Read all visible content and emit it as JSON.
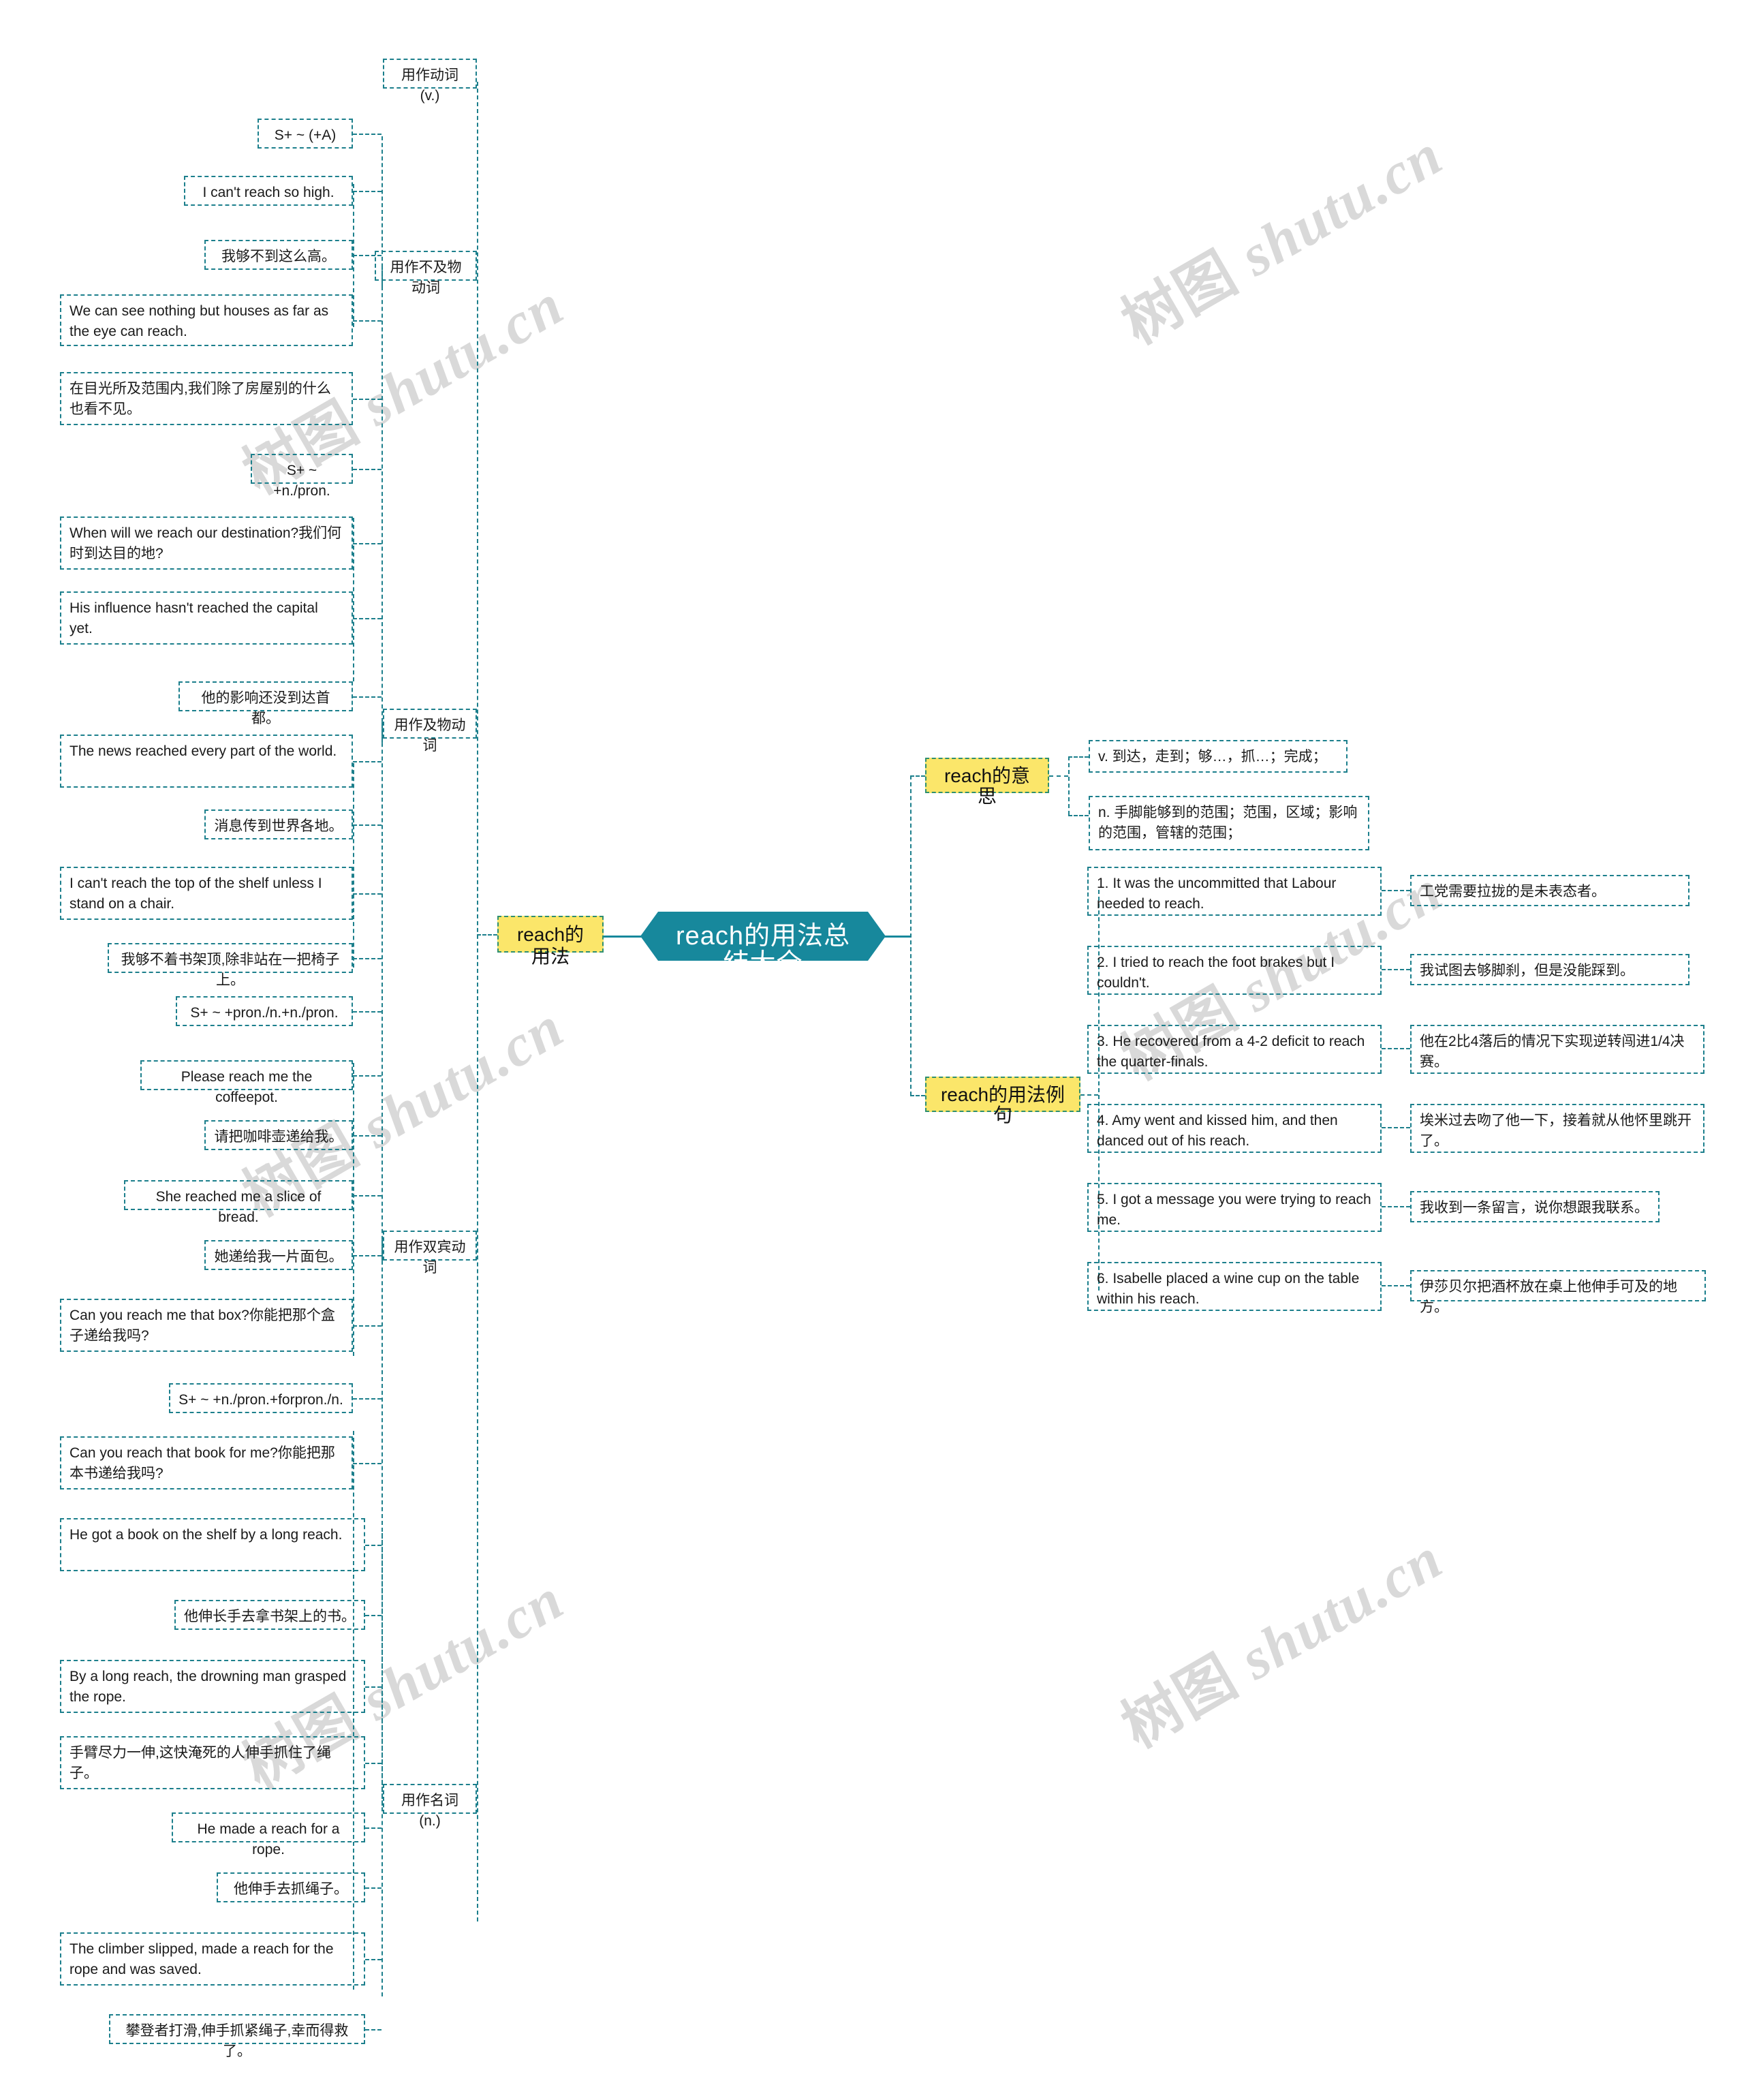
{
  "diagram": {
    "type": "mindmap",
    "center": {
      "label": "reach的用法总结大全",
      "color": "#17889c"
    },
    "watermark_text_cjk": "树图",
    "watermark_text_latin": "shutu.cn",
    "accent_border": "#1c7f8c",
    "highlight_fill": "#fbe66a"
  },
  "left": {
    "root": {
      "label": "reach的用法"
    },
    "branches": [
      {
        "label": "用作动词(v.)"
      },
      {
        "label": "用作不及物动词"
      },
      {
        "label": "用作及物动词"
      },
      {
        "label": "用作双宾动词"
      },
      {
        "label": "用作名词(n.)"
      }
    ],
    "patterns": [
      {
        "label": "S+ ~ (+A)"
      },
      {
        "label": "S+ ~ +n./pron."
      },
      {
        "label": "S+ ~ +pron./n.+n./pron."
      },
      {
        "label": "S+ ~ +n./pron.+forpron./n."
      }
    ],
    "leaves": [
      {
        "id": "l1",
        "text": "I can't reach so high."
      },
      {
        "id": "l2",
        "text": "我够不到这么高。"
      },
      {
        "id": "l3",
        "text": "We can see nothing but houses as far as the eye can reach."
      },
      {
        "id": "l4",
        "text": "在目光所及范围内,我们除了房屋别的什么也看不见。"
      },
      {
        "id": "l5",
        "text": "When will we reach our destination?我们何时到达目的地?"
      },
      {
        "id": "l6",
        "text": "His influence hasn't reached the capital yet."
      },
      {
        "id": "l7",
        "text": "他的影响还没到达首都。"
      },
      {
        "id": "l8",
        "text": "The news reached every part of the world."
      },
      {
        "id": "l9",
        "text": "消息传到世界各地。"
      },
      {
        "id": "l10",
        "text": "I can't reach the top of the shelf unless I stand on a chair."
      },
      {
        "id": "l11",
        "text": "我够不着书架顶,除非站在一把椅子上。"
      },
      {
        "id": "l12",
        "text": "Please reach me the coffeepot."
      },
      {
        "id": "l13",
        "text": "请把咖啡壶递给我。"
      },
      {
        "id": "l14",
        "text": "She reached me a slice of bread."
      },
      {
        "id": "l15",
        "text": "她递给我一片面包。"
      },
      {
        "id": "l16",
        "text": "Can you reach me that box?你能把那个盒子递给我吗?"
      },
      {
        "id": "l17",
        "text": "Can you reach that book for me?你能把那本书递给我吗?"
      },
      {
        "id": "l18",
        "text": "He got a book on the shelf by a long reach."
      },
      {
        "id": "l19",
        "text": "他伸长手去拿书架上的书。"
      },
      {
        "id": "l20",
        "text": "By a long reach, the drowning man grasped the rope."
      },
      {
        "id": "l21",
        "text": "手臂尽力一伸,这快淹死的人伸手抓住了绳子。"
      },
      {
        "id": "l22",
        "text": "He made a reach for a rope."
      },
      {
        "id": "l23",
        "text": "他伸手去抓绳子。"
      },
      {
        "id": "l24",
        "text": "The climber slipped, made a reach for the rope and was saved."
      },
      {
        "id": "l25",
        "text": "攀登者打滑,伸手抓紧绳子,幸而得救了。"
      }
    ]
  },
  "right": {
    "meaning": {
      "label": "reach的意思",
      "items": [
        "v. 到达，走到；够…，抓…；完成；",
        "n. 手脚能够到的范围；范围，区域；影响的范围，管辖的范围；"
      ]
    },
    "examples": {
      "label": "reach的用法例句",
      "items": [
        {
          "en": "1. It was the uncommitted that Labour needed to reach.",
          "zh": "工党需要拉拢的是未表态者。"
        },
        {
          "en": "2. I tried to reach the foot brakes but I couldn't.",
          "zh": "我试图去够脚刹，但是没能踩到。"
        },
        {
          "en": "3. He recovered from a 4-2 deficit to reach the quarter-finals.",
          "zh": "他在2比4落后的情况下实现逆转闯进1/4决赛。"
        },
        {
          "en": "4. Amy went and kissed him, and then danced out of his reach.",
          "zh": "埃米过去吻了他一下，接着就从他怀里跳开了。"
        },
        {
          "en": "5. I got a message you were trying to reach me.",
          "zh": "我收到一条留言，说你想跟我联系。"
        },
        {
          "en": "6. Isabelle placed a wine cup on the table within his reach.",
          "zh": "伊莎贝尔把酒杯放在桌上他伸手可及的地方。"
        }
      ]
    }
  }
}
